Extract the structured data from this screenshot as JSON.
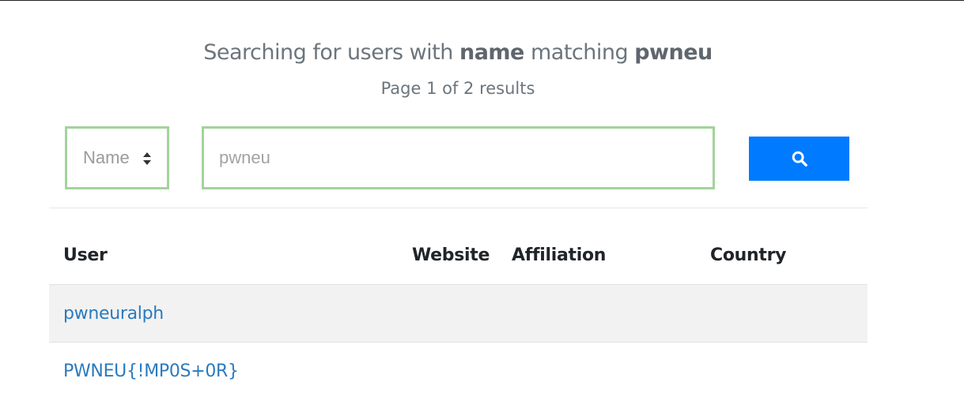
{
  "heading": {
    "prefix": "Searching for users with",
    "field": "name",
    "middle": "matching",
    "query": "pwneu"
  },
  "subheading": "Page 1 of 2 results",
  "search": {
    "field_selected": "Name",
    "value": "pwneu",
    "button_icon": "search-icon"
  },
  "colors": {
    "accent": "#007bff",
    "input_border": "#a3d39c",
    "link": "#2a7abf"
  },
  "table": {
    "headers": [
      "User",
      "Website",
      "Affiliation",
      "Country"
    ],
    "rows": [
      {
        "user": "pwneuralph",
        "website": "",
        "affiliation": "",
        "country": ""
      },
      {
        "user": "PWNEU{!MP0S+0R}",
        "website": "",
        "affiliation": "",
        "country": ""
      }
    ]
  }
}
